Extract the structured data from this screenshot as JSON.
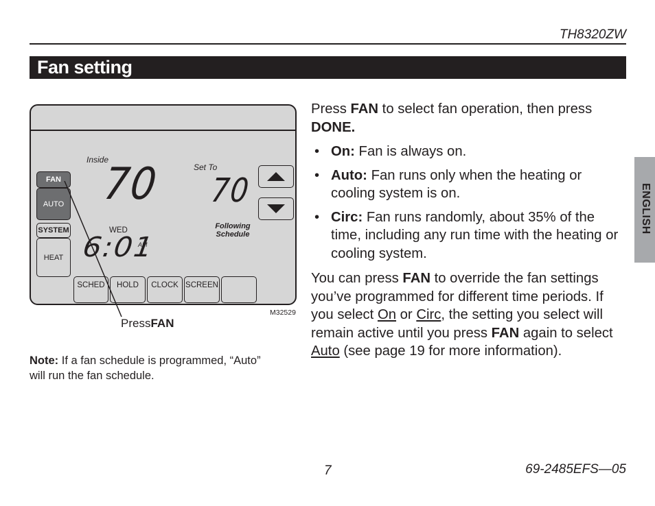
{
  "header": {
    "model": "TH8320ZW",
    "section_title": "Fan setting"
  },
  "figure": {
    "inside_label": "Inside",
    "inside_temp": "70",
    "set_to_label": "Set To",
    "set_temp": "70",
    "day": "WED",
    "time": "6:01",
    "ampm": "AM",
    "schedule_status": [
      "Following",
      "Schedule"
    ],
    "side_buttons": {
      "fan": "FAN",
      "fan_mode": "AUTO",
      "system": "SYSTEM",
      "system_mode": "HEAT"
    },
    "arrow_up_icon": "triangle-up",
    "arrow_down_icon": "triangle-down",
    "soft_buttons": [
      "SCHED",
      "HOLD",
      "CLOCK",
      "SCREEN",
      ""
    ],
    "figure_id": "M32529",
    "callout_prefix": "Press",
    "callout_key": "FAN"
  },
  "note": {
    "label": "Note:",
    "text": " If a fan schedule is programmed, “Auto” will run the fan schedule."
  },
  "body": {
    "intro": {
      "t1": "Press ",
      "k1": "FAN",
      "t2": " to select fan operation, then press ",
      "k2": "DONE."
    },
    "bullets": [
      {
        "term": "On:",
        "text": " Fan is always on."
      },
      {
        "term": "Auto:",
        "text": " Fan runs only when the heating or cooling system is on."
      },
      {
        "term": "Circ:",
        "text": " Fan runs randomly, about 35% of the time, including any run time with the heating or cooling system."
      }
    ],
    "override": {
      "t1": "You can press ",
      "k1": "FAN",
      "t2": " to override the fan settings you’ve programmed for different time periods. If you select ",
      "u1": "On",
      "t3": " or ",
      "u2": "Circ",
      "t4": ", the setting you select will remain active until you press ",
      "k2": "FAN",
      "t5": " again to select ",
      "u3": "Auto",
      "t6": " (see page 19 for more information)."
    }
  },
  "side_tab": {
    "language": "ENGLISH"
  },
  "footer": {
    "page_number": "7",
    "doc_number": "69-2485EFS—05"
  }
}
